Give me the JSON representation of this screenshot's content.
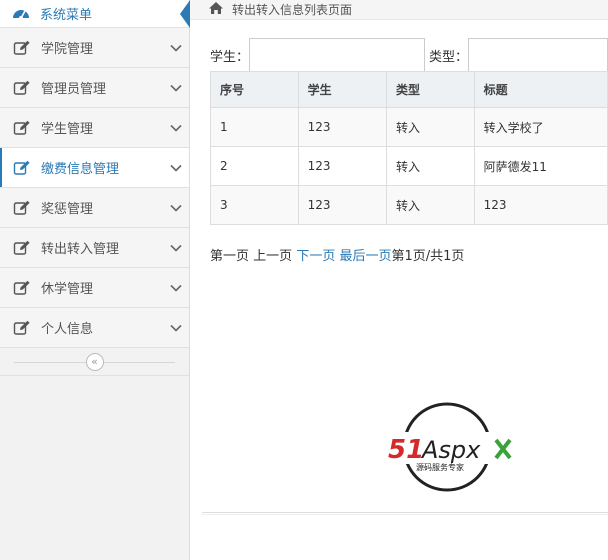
{
  "sidebar": {
    "title": "系统菜单",
    "items": [
      {
        "label": "学院管理",
        "active": false
      },
      {
        "label": "管理员管理",
        "active": false
      },
      {
        "label": "学生管理",
        "active": false
      },
      {
        "label": "缴费信息管理",
        "active": true
      },
      {
        "label": "奖惩管理",
        "active": false
      },
      {
        "label": "转出转入管理",
        "active": false
      },
      {
        "label": "休学管理",
        "active": false
      },
      {
        "label": "个人信息",
        "active": false
      }
    ],
    "collapse_glyph": "«"
  },
  "breadcrumb": {
    "text": "转出转入信息列表页面"
  },
  "search": {
    "student_label": "学生：",
    "student_value": "",
    "type_label": "类型：",
    "type_value": ""
  },
  "table": {
    "headers": [
      "序号",
      "学生",
      "类型",
      "标题"
    ],
    "rows": [
      [
        "1",
        "123",
        "转入",
        "转入学校了"
      ],
      [
        "2",
        "123",
        "转入",
        "阿萨德发11"
      ],
      [
        "3",
        "123",
        "转入",
        "123"
      ]
    ]
  },
  "pager": {
    "first": "第一页",
    "prev": "上一页",
    "next": "下一页",
    "last": "最后一页",
    "info": "第1页/共1页"
  },
  "logo": {
    "brand": "51Aspx",
    "tagline": "源码服务专家"
  },
  "colors": {
    "accent": "#2a7ab5",
    "logo_red": "#d42a2a",
    "logo_green": "#3aa23a"
  }
}
